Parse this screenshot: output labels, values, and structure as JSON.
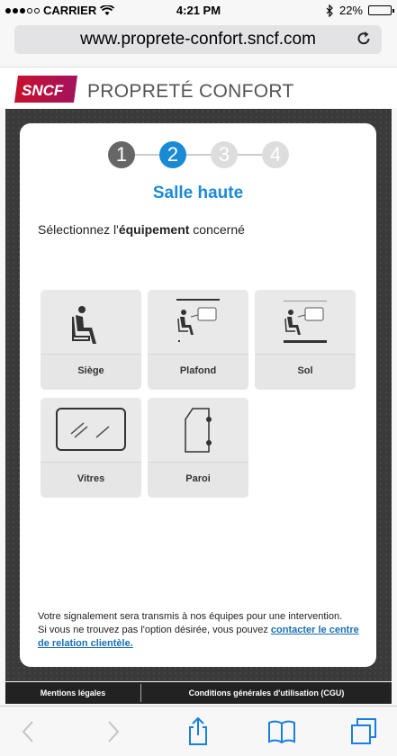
{
  "status_bar": {
    "carrier": "CARRIER",
    "time": "4:21 PM",
    "battery": "22%",
    "battery_level": 0.22
  },
  "browser": {
    "url": "www.proprete-confort.sncf.com"
  },
  "header": {
    "logo_text": "SNCF",
    "title": "PROPRETÉ CONFORT"
  },
  "steps": [
    {
      "number": "1",
      "state": "done"
    },
    {
      "number": "2",
      "state": "active"
    },
    {
      "number": "3",
      "state": "todo"
    },
    {
      "number": "4",
      "state": "todo"
    }
  ],
  "section_title": "Salle haute",
  "prompt": {
    "before": "Sélectionnez l'",
    "bold": "équipement",
    "after": " concerné"
  },
  "options": [
    {
      "label": "Siège",
      "icon": "seat-icon"
    },
    {
      "label": "Plafond",
      "icon": "ceiling-icon"
    },
    {
      "label": "Sol",
      "icon": "floor-icon"
    },
    {
      "label": "Vitres",
      "icon": "window-icon"
    },
    {
      "label": "Paroi",
      "icon": "wall-door-icon"
    }
  ],
  "note": {
    "line1": "Votre signalement sera transmis à nos équipes pour une intervention.",
    "line2": "Si vous ne trouvez pas l'option désirée, vous pouvez ",
    "link": "contacter le centre de relation clientèle."
  },
  "legal": {
    "left": "Mentions légales",
    "right": "Conditions générales d'utilisation (CGU)"
  },
  "colors": {
    "accent": "#1a8ad4",
    "done_step": "#666666",
    "todo_step": "#dddddd",
    "logo_red": "#c8102e"
  }
}
